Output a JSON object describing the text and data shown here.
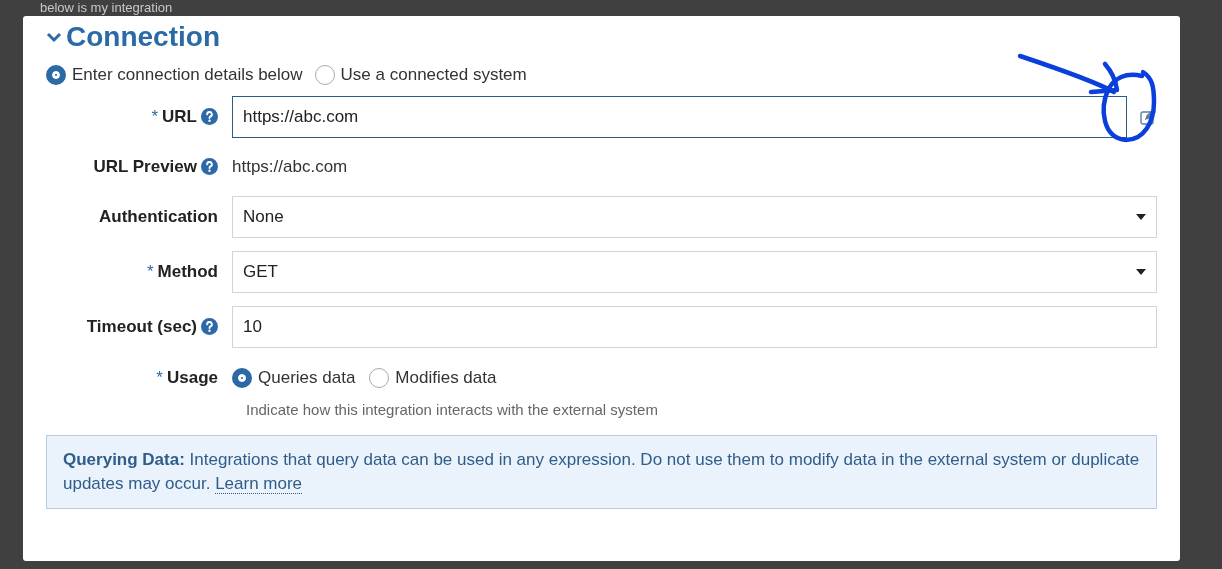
{
  "background_text": "below is my integration",
  "section": {
    "title": "Connection",
    "expanded": true
  },
  "source_options": [
    {
      "label": "Enter connection details below",
      "selected": true
    },
    {
      "label": "Use a connected system",
      "selected": false
    }
  ],
  "fields": [
    {
      "kind": "input",
      "label": "URL",
      "required_mark": "*",
      "help": true,
      "value": "https://abc.com",
      "focused": true,
      "editor_button": true
    },
    {
      "kind": "text",
      "label": "URL Preview",
      "help": true,
      "value": "https://abc.com"
    },
    {
      "kind": "select",
      "label": "Authentication",
      "help": false,
      "value": "None"
    },
    {
      "kind": "select",
      "label": "Method",
      "required_mark": "*",
      "help": false,
      "value": "GET"
    },
    {
      "kind": "input",
      "label": "Timeout (sec)",
      "help": true,
      "value": "10",
      "focused": false,
      "editor_button": false
    },
    {
      "kind": "radio",
      "label": "Usage",
      "required_mark": "*",
      "help": false,
      "options": [
        {
          "label": "Queries data",
          "selected": true
        },
        {
          "label": "Modifies data",
          "selected": false
        }
      ],
      "hint": "Indicate how this integration interacts with the external system"
    }
  ],
  "info": {
    "text": "**Querying Data:** Integrations that query data can be used in any expression. Do not use them to modify data in the external system or duplicate updates may occur.",
    "link": "Learn more"
  }
}
